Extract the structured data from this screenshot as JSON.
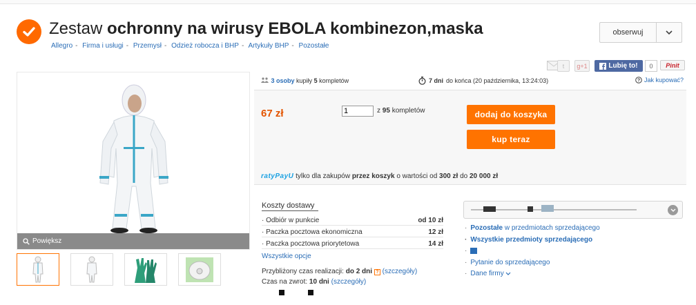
{
  "header": {
    "title_pre": "Zestaw",
    "title_main": " ochronny na wirusy EBOLA kombinezon,maska",
    "breadcrumb": [
      "Allegro",
      "Firma i usługi",
      "Przemysł",
      "Odzież robocza i BHP",
      "Artykuły BHP",
      "Pozostałe"
    ],
    "watch_label": "obserwuj"
  },
  "social": {
    "gplus": "g+1",
    "like_label": "Lubię to!",
    "like_count": "0",
    "pin_label": "Pinit"
  },
  "gallery": {
    "zoom_label": "Powiększ",
    "thumbnails": [
      "kombinezon-front",
      "kombinezon-back",
      "rekawice",
      "maska"
    ]
  },
  "offer": {
    "buyers_count": "3 osoby",
    "buyers_text": "kupiły",
    "sets_count": "5",
    "sets_word": "kompletów",
    "days_left": "7 dni",
    "until_text": "do końca (20 października, 13:24:03)",
    "how_to_buy": "Jak kupować?",
    "price": "67 zł",
    "quantity": "1",
    "of_label": "z",
    "available": "95",
    "available_unit": "kompletów",
    "add_to_cart": "dodaj do koszyka",
    "buy_now": "kup teraz"
  },
  "raty": {
    "brand": "ratyPayU",
    "text1": "tylko dla zakupów",
    "cart_bold": "przez koszyk",
    "text2": "o wartości od",
    "min": "300 zł",
    "text3": "do",
    "max": "20 000 zł"
  },
  "shipping": {
    "heading": "Koszty dostawy",
    "rows": [
      {
        "label": "Odbiór w punkcie",
        "value": "od 10 zł"
      },
      {
        "label": "Paczka pocztowa ekonomiczna",
        "value": "12 zł"
      },
      {
        "label": "Paczka pocztowa priorytetowa",
        "value": "14 zł"
      }
    ],
    "all_options": "Wszystkie opcje",
    "realization_label": "Przybliżony czas realizacji:",
    "realization_value": "do 2 dni",
    "details": "(szczegóły)",
    "return_label": "Czas na zwrot:",
    "return_value": "10 dni"
  },
  "seller": {
    "other_bold": "Pozostałe",
    "other_rest": "w przedmiotach sprzedającego",
    "all_items": "Wszystkie przedmioty sprzedającego",
    "ask": "Pytanie do sprzedającego",
    "company": "Dane firmy"
  },
  "colors": {
    "accent": "#ff7300",
    "link": "#2a6db6",
    "price": "#e35400"
  }
}
